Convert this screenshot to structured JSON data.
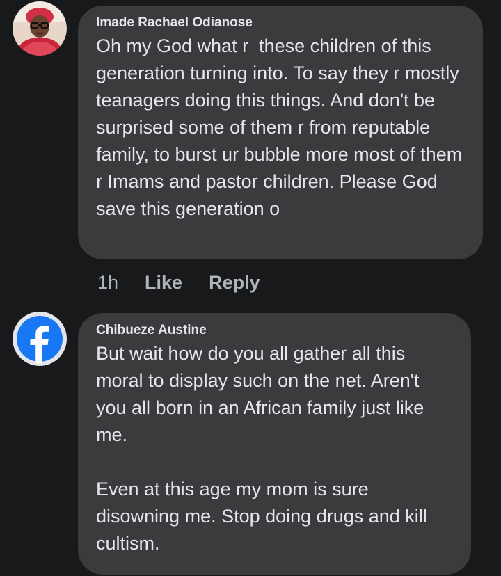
{
  "comments": [
    {
      "author": "Imade Rachael Odianose",
      "text": "Oh my God what r  these children of this generation turning into. To say they r mostly teanagers doing this things. And don't be surprised some of them r from reputable family, to burst ur bubble more most of them r Imams and pastor children. Please God save this generation o",
      "time": "1h",
      "like_label": "Like",
      "reply_label": "Reply",
      "avatar": "user-photo"
    },
    {
      "author": "Chibueze Austine",
      "text": "But wait how do you all gather all this moral to display such on the net. Aren't you all born in an African family just like me.\n\nEven at this age my mom is sure disowning me. Stop doing drugs and kill cultism.",
      "avatar": "facebook-default-icon"
    }
  ],
  "colors": {
    "background": "#18191a",
    "bubble": "#3a3b3c",
    "text": "#e4e6eb",
    "meta": "#b0b3b8",
    "facebook_blue": "#1877f2"
  }
}
